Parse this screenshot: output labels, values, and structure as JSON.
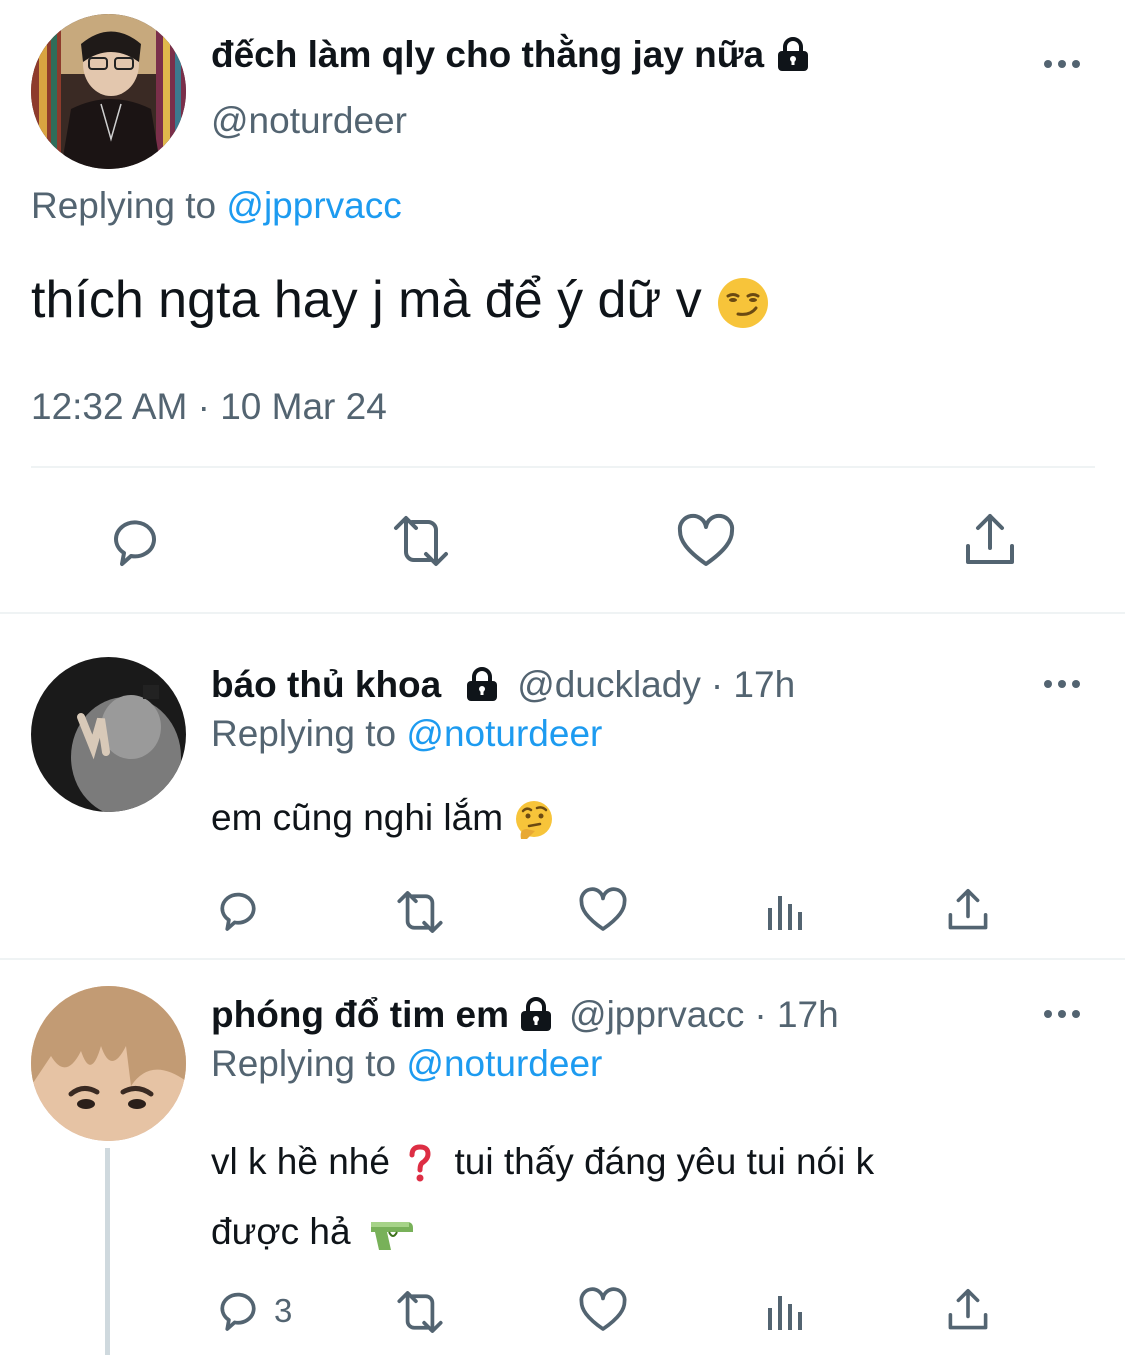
{
  "main_tweet": {
    "display_name": "đếch làm qly cho thằng jay nữa",
    "handle": "@noturdeer",
    "replying_label": "Replying to",
    "replying_to": "@jpprvacc",
    "text": "thích ngta hay j mà để ý dữ v",
    "emoji": "smirking-face",
    "timestamp": "12:32 AM · 10 Mar 24",
    "actions": [
      "reply",
      "retweet",
      "like",
      "share"
    ]
  },
  "replies": [
    {
      "display_name": "báo thủ khoa",
      "handle": "@ducklady",
      "time": "· 17h",
      "replying_label": "Replying to",
      "replying_to": "@noturdeer",
      "text": "em cũng nghi lắm",
      "emoji": "thinking-face",
      "reply_count": ""
    },
    {
      "display_name": "phóng đổ tim em",
      "handle": "@jpprvacc",
      "time": "· 17h",
      "replying_label": "Replying to",
      "replying_to": "@noturdeer",
      "text_line1": "vl k hề nhé",
      "text_line1b": "tui thấy đáng yêu tui nói k",
      "text_line2": "được hả",
      "emojis": [
        "red-question-mark",
        "water-pistol"
      ],
      "reply_count": "3"
    }
  ],
  "colors": {
    "text": "#0f1419",
    "secondary": "#536471",
    "link": "#1d9bf0",
    "divider": "#eff3f4"
  }
}
